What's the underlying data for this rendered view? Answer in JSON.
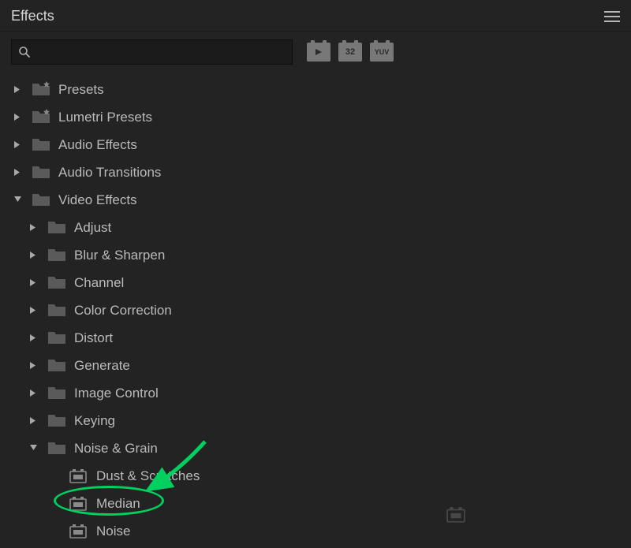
{
  "panel": {
    "title": "Effects"
  },
  "search": {
    "placeholder": ""
  },
  "filters": {
    "accelerated": "accelerated",
    "thirtytwo": "32",
    "yuv": "YUV"
  },
  "tree": {
    "presets": {
      "label": "Presets",
      "expanded": false
    },
    "lumetri_presets": {
      "label": "Lumetri Presets",
      "expanded": false
    },
    "audio_effects": {
      "label": "Audio Effects",
      "expanded": false
    },
    "audio_transitions": {
      "label": "Audio Transitions",
      "expanded": false
    },
    "video_effects": {
      "label": "Video Effects",
      "expanded": true,
      "children": {
        "adjust": {
          "label": "Adjust",
          "expanded": false
        },
        "blur_sharpen": {
          "label": "Blur & Sharpen",
          "expanded": false
        },
        "channel": {
          "label": "Channel",
          "expanded": false
        },
        "color_correction": {
          "label": "Color Correction",
          "expanded": false
        },
        "distort": {
          "label": "Distort",
          "expanded": false
        },
        "generate": {
          "label": "Generate",
          "expanded": false
        },
        "image_control": {
          "label": "Image Control",
          "expanded": false
        },
        "keying": {
          "label": "Keying",
          "expanded": false
        },
        "noise_grain": {
          "label": "Noise & Grain",
          "expanded": true,
          "children": {
            "dust_scratches": {
              "label": "Dust & Scratches"
            },
            "median": {
              "label": "Median"
            },
            "noise": {
              "label": "Noise"
            }
          }
        }
      }
    }
  }
}
